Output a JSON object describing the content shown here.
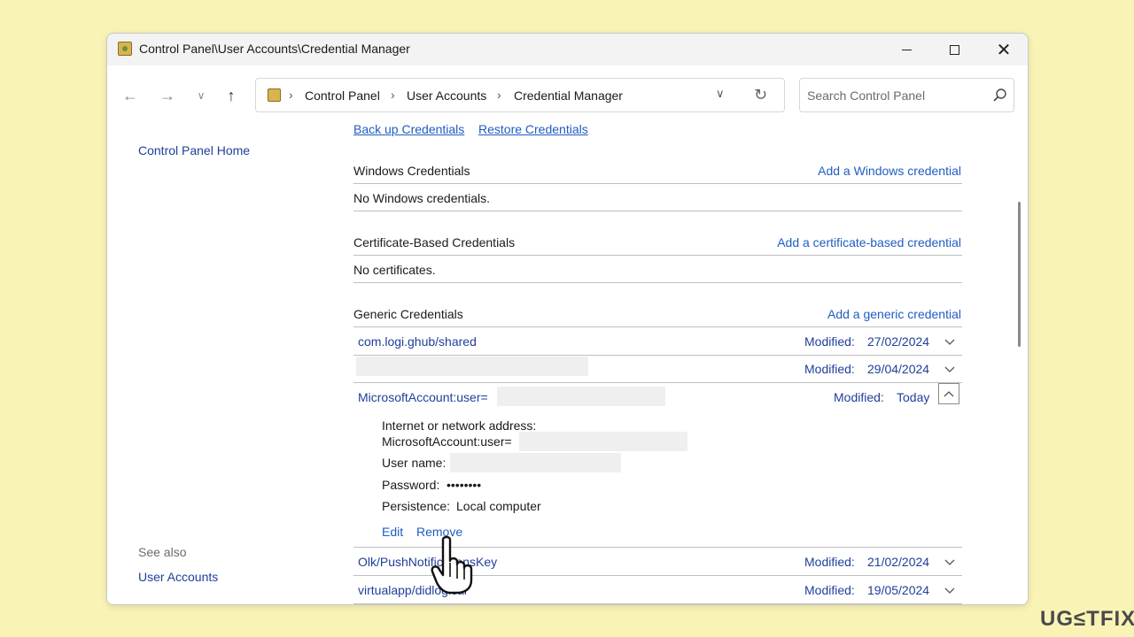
{
  "window": {
    "title": "Control Panel\\User Accounts\\Credential Manager"
  },
  "nav": {
    "breadcrumbs": [
      "Control Panel",
      "User Accounts",
      "Credential Manager"
    ],
    "search_placeholder": "Search Control Panel"
  },
  "left": {
    "home": "Control Panel Home",
    "see_also": "See also",
    "user_accounts": "User Accounts"
  },
  "top_links": {
    "backup": "Back up Credentials",
    "restore": "Restore Credentials"
  },
  "windows_credentials": {
    "heading": "Windows Credentials",
    "add": "Add a Windows credential",
    "empty": "No Windows credentials."
  },
  "certificate_credentials": {
    "heading": "Certificate-Based Credentials",
    "add": "Add a certificate-based credential",
    "empty": "No certificates."
  },
  "generic_credentials": {
    "heading": "Generic Credentials",
    "add": "Add a generic credential",
    "modified_label": "Modified:",
    "rows": [
      {
        "name": "com.logi.ghub/shared",
        "date": "27/02/2024"
      },
      {
        "name": "",
        "date": "29/04/2024"
      },
      {
        "name": "MicrosoftAccount:user=",
        "date": "Today"
      },
      {
        "name": "Olk/PushNotificationsKey",
        "date": "21/02/2024"
      },
      {
        "name": "virtualapp/didlogical",
        "date": "19/05/2024"
      }
    ]
  },
  "details": {
    "address_label": "Internet or network address:",
    "address_value": "MicrosoftAccount:user=",
    "username_label": "User name:",
    "password_label": "Password:",
    "password_value": "••••••••",
    "persistence_label": "Persistence:",
    "persistence_value": "Local computer",
    "edit": "Edit",
    "remove": "Remove"
  },
  "brand": "UG≤TFIX",
  "colors": {
    "background": "#f9f4b6",
    "link": "#1f5dc2",
    "nav_link": "#1f3f9a"
  }
}
